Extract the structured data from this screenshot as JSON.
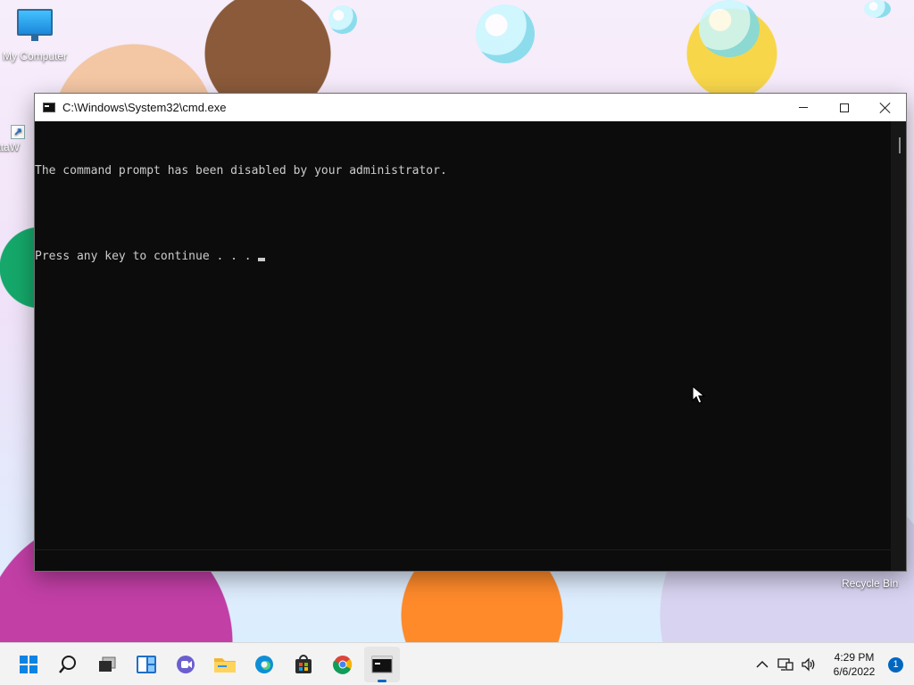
{
  "desktop": {
    "icons": [
      {
        "label": "My Computer"
      },
      {
        "label": "DataW"
      }
    ],
    "recycle_bin_label": "Recycle Bin"
  },
  "cmd_window": {
    "title": "C:\\Windows\\System32\\cmd.exe",
    "lines": [
      "The command prompt has been disabled by your administrator.",
      "",
      "Press any key to continue . . . "
    ]
  },
  "taskbar": {
    "apps": [
      {
        "name": "start-button"
      },
      {
        "name": "search-button"
      },
      {
        "name": "task-view-button"
      },
      {
        "name": "widgets-button"
      },
      {
        "name": "teams-chat-button"
      },
      {
        "name": "file-explorer-button"
      },
      {
        "name": "edge-button"
      },
      {
        "name": "store-button"
      },
      {
        "name": "chrome-button"
      },
      {
        "name": "command-prompt-button",
        "active": true
      }
    ],
    "clock_time": "4:29 PM",
    "clock_date": "6/6/2022",
    "notification_count": "1",
    "accent_color": "#0067c0"
  }
}
